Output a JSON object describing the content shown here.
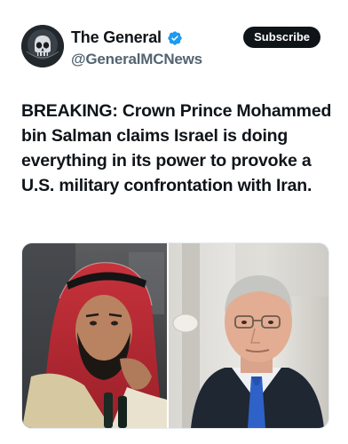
{
  "account": {
    "display_name": "The General",
    "handle": "@GeneralMCNews",
    "verified": true,
    "verified_color": "#1d9bf0",
    "avatar_icon": "skull-avatar"
  },
  "actions": {
    "subscribe_label": "Subscribe"
  },
  "post": {
    "text": "BREAKING: Crown Prince Mohammed bin Salman claims Israel is doing everything in its power to provoke a U.S. military confrontation with Iran."
  },
  "media": {
    "type": "photo-collage",
    "panels": [
      "left-photo",
      "right-photo"
    ]
  }
}
